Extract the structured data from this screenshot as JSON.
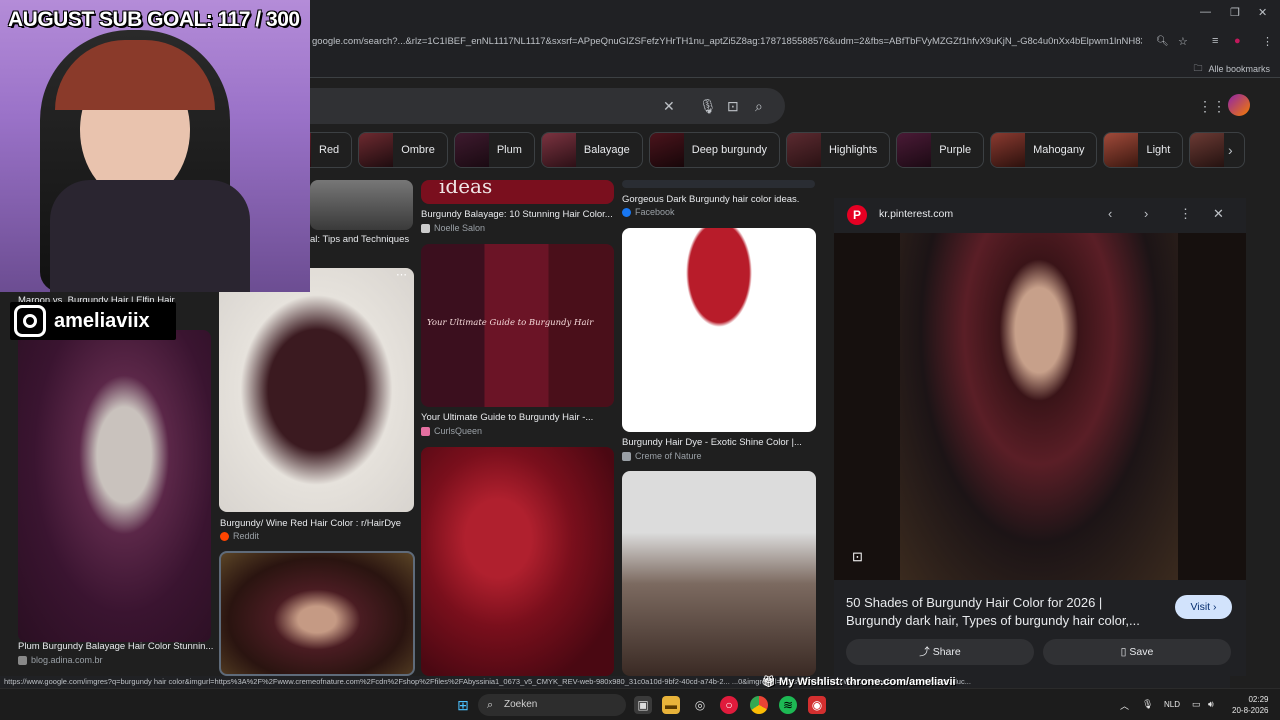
{
  "browser": {
    "url": "google.com/search?...&rlz=1C1IBEF_enNL1117NL1117&sxsrf=APpeQnuGIZSFefzYHrTH1nu_aptZi5Z8ag:1787185588576&udm=2&fbs=ABfTbFVyMZGZf1hfvX9uKjN_-G8c4u0nXx4bElpwm1lnNH832b1sC3PQ-MLX4CbUrRwXd2y...",
    "bookmarks_all": "Alle bookmarks",
    "status_url": "https://www.google.com/imgres?q=burgundy hair color&imgurl=https%3A%2F%2Fwww.cremeofnature.com%2Fcdn%2Fshop%2Ffiles%2FAbyssinia1_0673_v5_CMYK_REV-web-980x980_31c0a10d-9bf2-40cd-a74b-2... ...0&imgrefurl=https%3A%2F%2Fwww.cremeofnature.com%2Fproduc..."
  },
  "chips": [
    "Red",
    "Ombre",
    "Plum",
    "Balayage",
    "Deep burgundy",
    "Highlights",
    "Purple",
    "Mahogany",
    "Light"
  ],
  "results": {
    "col0": [
      {
        "caption": "Maroon vs. Burgundy Hair | Elfin Hair"
      },
      {
        "caption": "Plum Burgundy Balayage Hair Color Stunnin...",
        "source": "blog.adina.com.br"
      }
    ],
    "col1": [
      {
        "caption": "al: Tips and Techniques"
      },
      {
        "caption": "Burgundy/ Wine Red Hair Color : r/HairDye",
        "source": "Reddit"
      }
    ],
    "col2": [
      {
        "caption": "Burgundy Balayage: 10 Stunning Hair Color...",
        "source": "Noelle Salon"
      },
      {
        "caption": "Your Ultimate Guide to Burgundy Hair -...",
        "source": "CurlsQueen",
        "image_text": "Your Ultimate Guide to Burgundy Hair"
      },
      {
        "image_text": "ideas"
      }
    ],
    "col3": [
      {
        "caption": "Gorgeous Dark Burgundy hair color ideas.",
        "source": "Facebook"
      },
      {
        "caption": "Burgundy Hair Dye - Exotic Shine Color |...",
        "source": "Creme of Nature"
      }
    ]
  },
  "preview": {
    "site": "kr.pinterest.com",
    "title": "50 Shades of Burgundy Hair Color for 2026 | Burgundy dark hair, Types of burgundy hair color,...",
    "visit_label": "Visit",
    "share_label": "Share",
    "save_label": "Save"
  },
  "taskbar": {
    "search_label": "Zoeken",
    "lang": "NLD",
    "time": "02:29",
    "date": "20-8-2026"
  },
  "overlay": {
    "sub_goal": "AUGUST SUB GOAL: 117 / 300",
    "instagram_handle": "ameliaviix",
    "wishlist": "My Wishlist: throne.com/ameliavii"
  }
}
